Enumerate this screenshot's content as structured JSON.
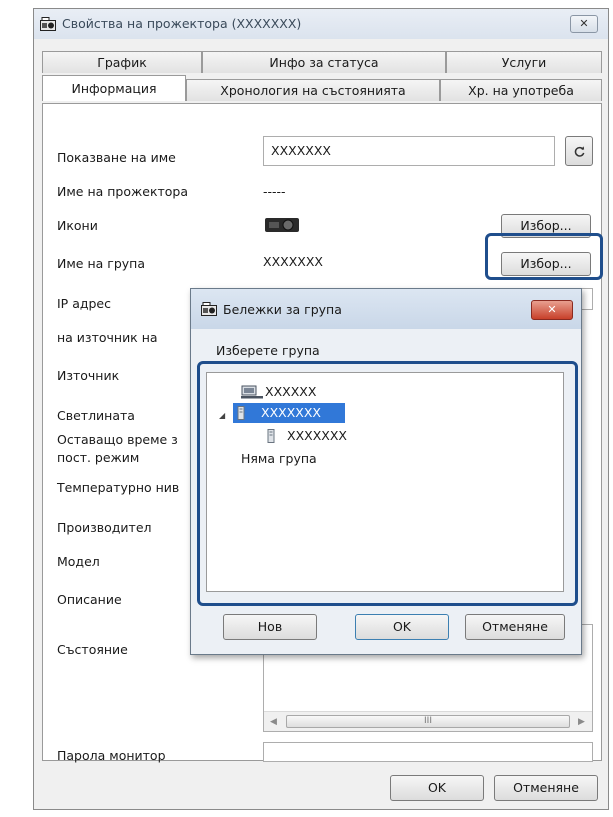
{
  "window": {
    "title": "Свойства на прожектора (XXXXXXX)",
    "close_glyph": "✕"
  },
  "tabs_row1": [
    "График",
    "Инфо за статуса",
    "Услуги"
  ],
  "tabs_row2": [
    "Информация",
    "Хронология на състоянията",
    "Хр. на употреба"
  ],
  "active_tab": "Информация",
  "labels": {
    "display_name": "Показване на име",
    "projector_name": "Име на прожектора",
    "icons": "Икони",
    "group_name": "Име на група",
    "ip_address": "IP адрес",
    "source_name": "на източник на",
    "source": "Източник",
    "brightness": "Светлината",
    "remaining_time_1": "Оставащо време з",
    "remaining_time_2": "пост. режим",
    "temperature": "Температурно нив",
    "manufacturer": "Производител",
    "model": "Модел",
    "description": "Описание",
    "status": "Състояние",
    "monitor_password": "Парола монитор"
  },
  "values": {
    "display_name": "XXXXXXX",
    "projector_name": "-----",
    "group_name": "XXXXXXX"
  },
  "buttons": {
    "icon_select": "Избор...",
    "group_select": "Избор...",
    "ok": "OK",
    "cancel": "Отменяне"
  },
  "scrollbar": {
    "grip": "III"
  },
  "dialog": {
    "title": "Бележки за група",
    "close_glyph": "✕",
    "prompt": "Изберете група",
    "tree": {
      "root": "XXXXXX",
      "group": "XXXXXXX",
      "child": "XXXXXXX",
      "none": "Няма група"
    },
    "new_button": "Нов",
    "ok_button": "OK",
    "cancel_button": "Отменяне"
  },
  "colors": {
    "highlight": "#1f4e8c",
    "selection": "#3178d8"
  }
}
